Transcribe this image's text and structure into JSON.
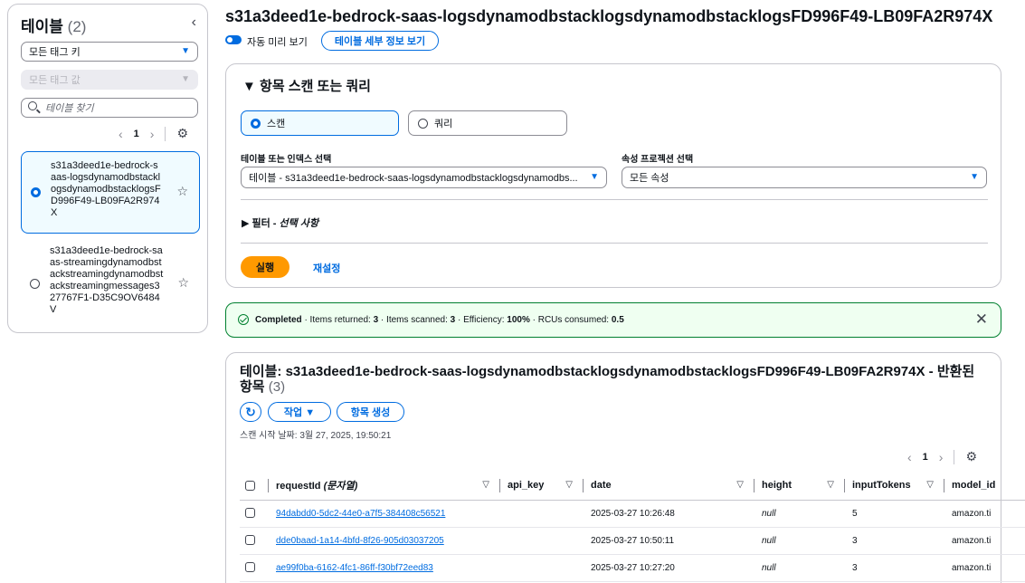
{
  "sidebar": {
    "title": "테이블",
    "count": "(2)",
    "collapse_icon": "‹",
    "tag_key_select": "모든 태그 키",
    "tag_value_select": "모든 태그 값",
    "search_placeholder": "테이블 찾기",
    "page": "1",
    "tables": [
      {
        "name": "s31a3deed1e-bedrock-saas-logsdynamodbstacklogsdynamodbstacklogsFD996F49-LB09FA2R974X",
        "selected": true
      },
      {
        "name": "s31a3deed1e-bedrock-saas-streamingdynamodbstackstreamingdynamodbstackstreamingmessages327767F1-D35C9OV6484V",
        "selected": false
      }
    ]
  },
  "header": {
    "title": "s31a3deed1e-bedrock-saas-logsdynamodbstacklogsdynamodbstacklogsFD996F49-LB09FA2R974X",
    "auto_preview_label": "자동 미리 보기",
    "details_button": "테이블 세부 정보 보기"
  },
  "scan_panel": {
    "title": "▼ 항목 스캔 또는 쿼리",
    "scan_label": "스캔",
    "query_label": "쿼리",
    "table_index_label": "테이블 또는 인덱스 선택",
    "table_index_value": "테이블 - s31a3deed1e-bedrock-saas-logsdynamodbstacklogsdynamodbs...",
    "projection_label": "속성 프로젝션 선택",
    "projection_value": "모든 속성",
    "filter_label": "▶ 필터 - ",
    "filter_optional": "선택 사항",
    "run_button": "실행",
    "reset_button": "재설정"
  },
  "alert": {
    "status": "Completed",
    "p1": " · Items returned: ",
    "items_returned": "3",
    "p2": " · Items scanned: ",
    "items_scanned": "3",
    "p3": " · Efficiency: ",
    "efficiency": "100%",
    "p4": " · RCUs consumed: ",
    "rcus": "0.5",
    "close_icon": "✕"
  },
  "results": {
    "title_prefix": "테이블: s31a3deed1e-bedrock-saas-logsdynamodbstacklogsdynamodbstacklogsFD996F49-LB09FA2R974X - 반환된 항목",
    "count": "(3)",
    "refresh_icon": "↻",
    "actions_button": "작업 ▼",
    "create_button": "항목 생성",
    "scan_date": "스캔 시작 날짜: 3월 27, 2025, 19:50:21",
    "page": "1",
    "columns": {
      "requestId": "requestId",
      "requestId_type": "(문자열)",
      "api_key": "api_key",
      "date": "date",
      "height": "height",
      "inputTokens": "inputTokens",
      "model_id": "model_id"
    },
    "rows": [
      {
        "requestId": "94dabdd0-5dc2-44e0-a7f5-384408c56521",
        "api_key": "",
        "date": "2025-03-27 10:26:48",
        "height": "null",
        "inputTokens": "5",
        "model_id": "amazon.ti"
      },
      {
        "requestId": "dde0baad-1a14-4bfd-8f26-905d03037205",
        "api_key": "",
        "date": "2025-03-27 10:50:11",
        "height": "null",
        "inputTokens": "3",
        "model_id": "amazon.ti"
      },
      {
        "requestId": "ae99f0ba-6162-4fc1-86ff-f30bf72eed83",
        "api_key": "",
        "date": "2025-03-27 10:27:20",
        "height": "null",
        "inputTokens": "3",
        "model_id": "amazon.ti"
      }
    ]
  }
}
